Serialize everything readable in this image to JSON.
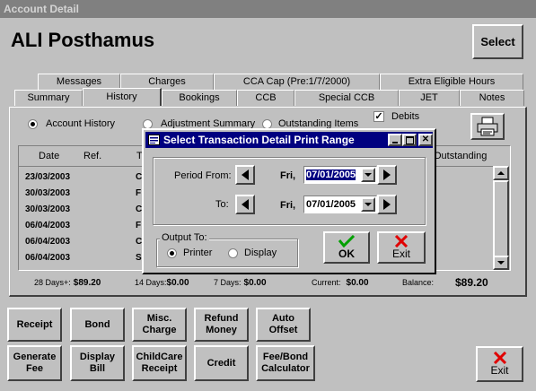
{
  "window": {
    "title": "Account Detail"
  },
  "patient_name": "ALI Posthamus",
  "select_label": "Select",
  "tabs_row1": [
    "Messages",
    "Charges",
    "CCA Cap (Pre:1/7/2000)",
    "Extra Eligible Hours"
  ],
  "tabs_row2": [
    "Summary",
    "History",
    "Bookings",
    "CCB",
    "Special CCB",
    "JET",
    "Notes"
  ],
  "active_tab": "History",
  "filters": {
    "account_history": "Account History",
    "adjustment_summary": "Adjustment Summary",
    "outstanding_items": "Outstanding Items",
    "debits": "Debits"
  },
  "grid": {
    "columns": {
      "date": "Date",
      "ref": "Ref.",
      "type": "T",
      "outstanding": "Outstanding"
    },
    "rows": [
      {
        "date": "23/03/2003",
        "t": "C"
      },
      {
        "date": "30/03/2003",
        "t": "F"
      },
      {
        "date": "30/03/2003",
        "t": "C"
      },
      {
        "date": "06/04/2003",
        "t": "F"
      },
      {
        "date": "06/04/2003",
        "t": "C"
      },
      {
        "date": "06/04/2003",
        "t": "S"
      }
    ]
  },
  "totals": {
    "d28_label": "28 Days+:",
    "d28_value": "$89.20",
    "d14_label": "14 Days:",
    "d14_value": "$0.00",
    "d7_label": "7 Days:",
    "d7_value": "$0.00",
    "current_label": "Current:",
    "current_value": "$0.00",
    "balance_label": "Balance:",
    "balance_value": "$89.20"
  },
  "dialog": {
    "title": "Select Transaction Detail Print Range",
    "period_from_label": "Period From:",
    "to_label": "To:",
    "from_day": "Fri,",
    "from_date_sel": "07/01/2005",
    "to_day": "Fri,",
    "to_date": "07/01/2005",
    "output_label": "Output To:",
    "printer": "Printer",
    "display": "Display",
    "ok": "OK",
    "exit": "Exit"
  },
  "buttons_row1": [
    "Receipt",
    "Bond",
    "Misc.\nCharge",
    "Refund\nMoney",
    "Auto\nOffset"
  ],
  "buttons_row2": [
    "Generate\nFee",
    "Display\nBill",
    "ChildCare\nReceipt",
    "Credit",
    "Fee/Bond\nCalculator"
  ],
  "exit_label": "Exit",
  "colors": {
    "title_active": "#000080",
    "ok_check": "#00a000",
    "exit_x": "#e00000"
  }
}
